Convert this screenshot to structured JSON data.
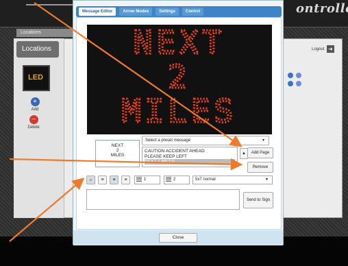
{
  "background": {
    "brand": "ontroller",
    "locations_tab": "Locations",
    "locations_button": "Locations",
    "led_tile": "LED",
    "add_label": "Add",
    "delete_label": "Delete",
    "logout_label": "Logout"
  },
  "modal": {
    "tabs": [
      {
        "label": "Message Editor",
        "active": true
      },
      {
        "label": "Arrow Modes",
        "active": false
      },
      {
        "label": "Settings",
        "active": false
      },
      {
        "label": "Control",
        "active": false
      }
    ],
    "led_display": {
      "lines": [
        "NEXT",
        "2",
        "MILES"
      ],
      "color": "#e8421c"
    },
    "preview_lines": [
      "NEXT",
      "2",
      "MILES"
    ],
    "preset_select_placeholder": "Select a preset message",
    "preset_messages": [
      "CAUTION ACCIDENT AHEAD",
      "PLEASE KEEP LEFT",
      "NEXT 2 MILES"
    ],
    "add_page_label": "Add Page",
    "remove_label": "Remove",
    "line_spacing_value": "1",
    "page_value": "2",
    "font_value": "5x7 normal",
    "send_label": "Send to Sign",
    "close_label": "Close"
  },
  "colors": {
    "accent": "#3d85c6",
    "annotation_arrow": "#f07a2a",
    "led_on": "#e8421c"
  }
}
